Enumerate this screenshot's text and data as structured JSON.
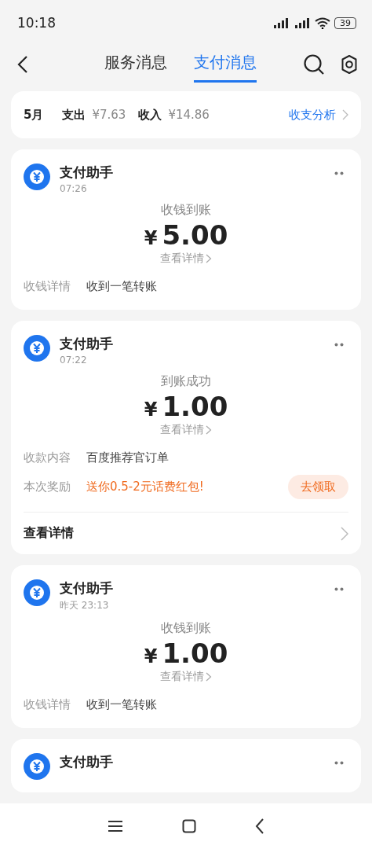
{
  "status_bar": {
    "time": "10:18",
    "battery": "39"
  },
  "tabs": [
    {
      "label": "服务消息",
      "selected": false
    },
    {
      "label": "支付消息",
      "selected": true
    }
  ],
  "summary": {
    "month": "5月",
    "expense_label": "支出",
    "expense": "¥7.63",
    "income_label": "收入",
    "income": "¥14.86",
    "link": "收支分析"
  },
  "messages": [
    {
      "sender": "支付助手",
      "time": "07:26",
      "title": "收钱到账",
      "currency": "¥",
      "amount": "5.00",
      "details_link": "查看详情",
      "rows": [
        {
          "kind": "plain",
          "label": "收钱详情",
          "value": "收到一笔转账"
        }
      ]
    },
    {
      "sender": "支付助手",
      "time": "07:22",
      "title": "到账成功",
      "currency": "¥",
      "amount": "1.00",
      "details_link": "查看详情",
      "rows": [
        {
          "kind": "plain",
          "label": "收款内容",
          "value": "百度推荐官订单"
        },
        {
          "kind": "reward",
          "label": "本次奖励",
          "value": "送你0.5-2元话费红包!",
          "action": "去领取"
        }
      ],
      "footer": "查看详情"
    },
    {
      "sender": "支付助手",
      "time": "昨天 23:13",
      "title": "收钱到账",
      "currency": "¥",
      "amount": "1.00",
      "details_link": "查看详情",
      "rows": [
        {
          "kind": "plain",
          "label": "收钱详情",
          "value": "收到一笔转账"
        }
      ]
    },
    {
      "sender": "支付助手"
    }
  ]
}
